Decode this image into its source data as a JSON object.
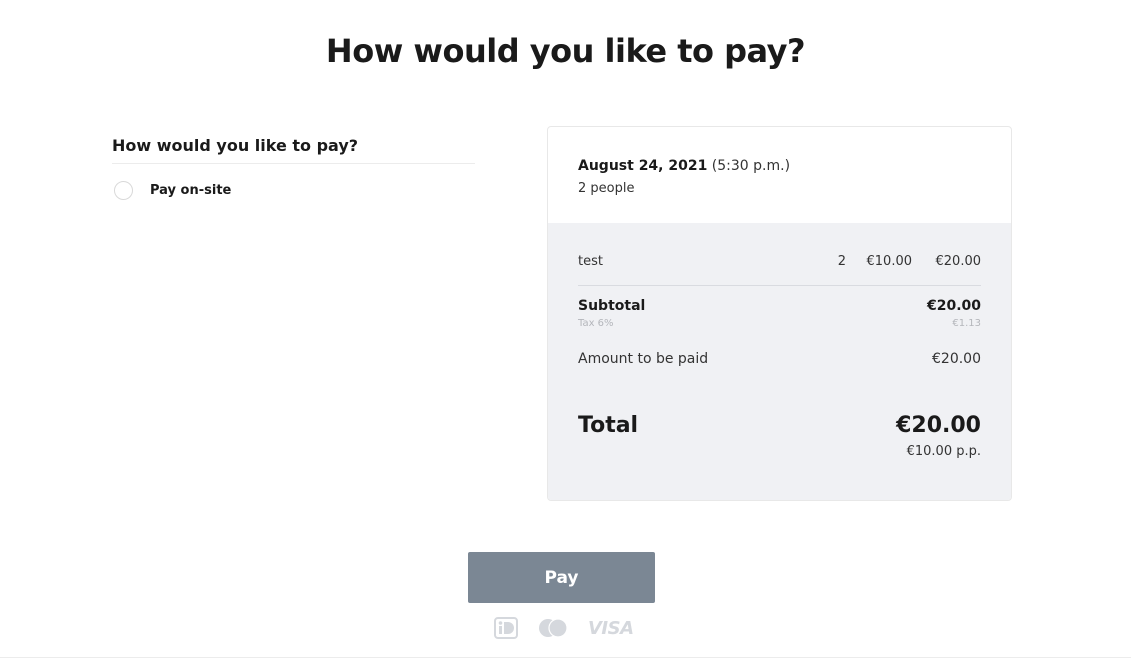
{
  "page": {
    "title": "How would you like to pay?"
  },
  "payment_methods": {
    "heading": "How would you like to pay?",
    "options": [
      {
        "label": "Pay on-site",
        "selected": false
      }
    ]
  },
  "booking": {
    "date": "August 24, 2021",
    "time": "(5:30 p.m.)",
    "people": "2 people"
  },
  "order": {
    "items": [
      {
        "name": "test",
        "qty": "2",
        "unit_price": "€10.00",
        "total": "€20.00"
      }
    ],
    "subtotal_label": "Subtotal",
    "subtotal_value": "€20.00",
    "tax_label": "Tax 6%",
    "tax_value": "€1.13",
    "amount_label": "Amount to be paid",
    "amount_value": "€20.00",
    "total_label": "Total",
    "total_value": "€20.00",
    "per_person": "€10.00 p.p."
  },
  "actions": {
    "pay_label": "Pay"
  },
  "payment_logos": {
    "ideal": "ideal-icon",
    "mastercard": "mastercard-icon",
    "visa_text": "VISA"
  },
  "colors": {
    "button": "#7b8794",
    "summary_bg": "#f0f1f4",
    "muted": "#b4b6bb"
  }
}
